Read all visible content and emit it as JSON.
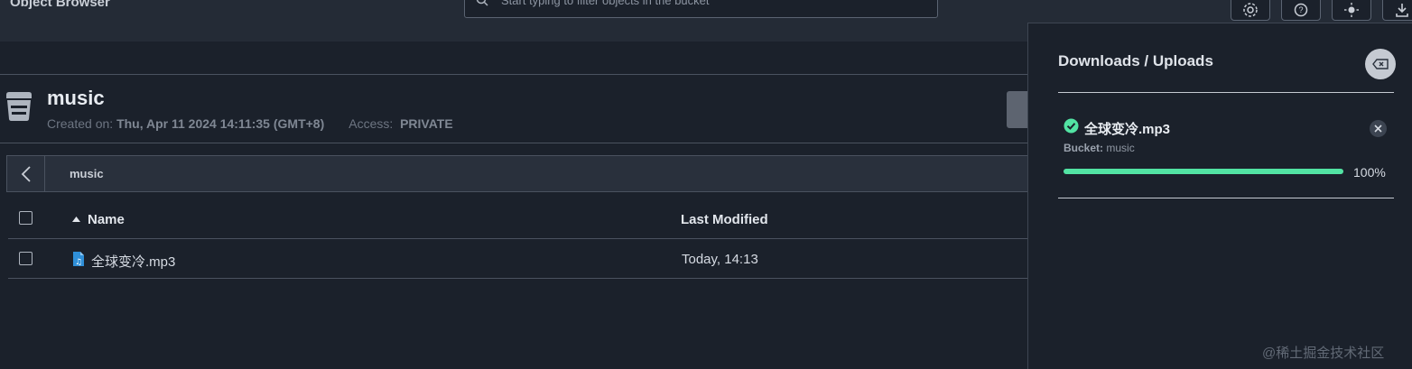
{
  "app": {
    "title": "Object Browser"
  },
  "search": {
    "placeholder": "Start typing to filter objects in the bucket"
  },
  "top_buttons": [
    {
      "icon": "gear-icon"
    },
    {
      "icon": "help-icon"
    },
    {
      "icon": "theme-icon"
    },
    {
      "icon": "downloads-icon"
    }
  ],
  "bucket": {
    "name": "music",
    "created_label": "Created on:",
    "created_value": "Thu, Apr 11 2024 14:11:35 (GMT+8)",
    "access_label": "Access:",
    "access_value": "PRIVATE"
  },
  "breadcrumb": {
    "path": "music"
  },
  "table": {
    "columns": {
      "name": "Name",
      "last_modified": "Last Modified"
    },
    "rows": [
      {
        "name": "全球变冷.mp3",
        "last_modified": "Today, 14:13"
      }
    ]
  },
  "panel": {
    "title": "Downloads / Uploads",
    "items": [
      {
        "name": "全球变冷.mp3",
        "bucket_label": "Bucket:",
        "bucket": "music",
        "progress": 100,
        "progress_text": "100%",
        "status": "complete"
      }
    ]
  },
  "watermark": "@稀土掘金技术社区",
  "colors": {
    "background": "#1b212b",
    "accent_success": "#52e3a3"
  }
}
